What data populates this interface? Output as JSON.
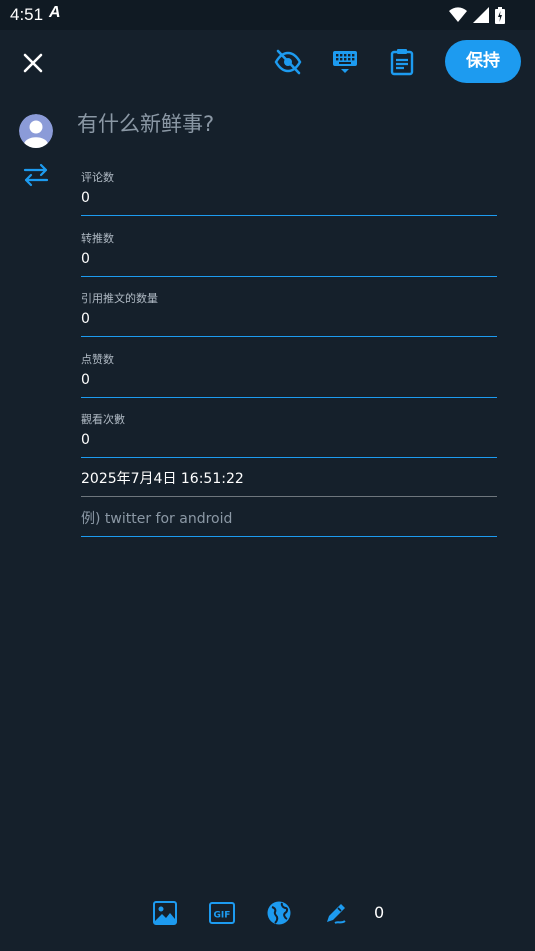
{
  "status": {
    "time": "4:51",
    "notif": "A"
  },
  "toolbar": {
    "save_label": "保持"
  },
  "compose": {
    "placeholder": "有什么新鲜事?"
  },
  "fields": [
    {
      "label": "评论数",
      "value": "0"
    },
    {
      "label": "转推数",
      "value": "0"
    },
    {
      "label": "引用推文的数量",
      "value": "0"
    },
    {
      "label": "点赞数",
      "value": "0"
    },
    {
      "label": "觀看次數",
      "value": "0"
    }
  ],
  "datetime": {
    "value": "2025年7月4日 16:51:22"
  },
  "source": {
    "placeholder": "例) twitter for android"
  },
  "bottom": {
    "count": "0"
  },
  "colors": {
    "accent": "#1d9bf0",
    "background": "#15202b",
    "statusbar": "#101a23"
  },
  "icons": [
    "close-icon",
    "eye-off-icon",
    "keyboard-icon",
    "clipboard-icon",
    "retweet-icon",
    "image-icon",
    "gif-icon",
    "globe-icon",
    "edit-icon"
  ]
}
